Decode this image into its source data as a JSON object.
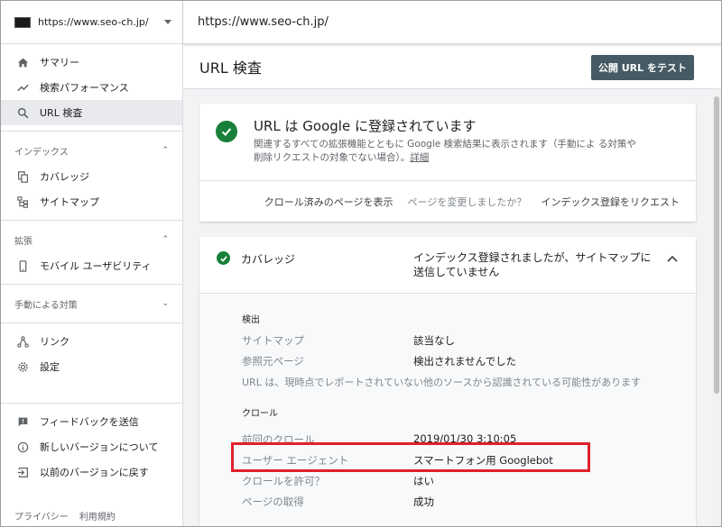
{
  "sidebar": {
    "property": "https://www.seo-ch.jp/",
    "nav_top": [
      {
        "label": "サマリー",
        "icon": "home-icon"
      },
      {
        "label": "検索パフォーマンス",
        "icon": "trending-up-icon"
      },
      {
        "label": "URL 検査",
        "icon": "search-icon",
        "active": true
      }
    ],
    "section_index": {
      "title": "インデックス",
      "items": [
        {
          "label": "カバレッジ",
          "icon": "copy-icon"
        },
        {
          "label": "サイトマップ",
          "icon": "sitemap-icon"
        }
      ]
    },
    "section_enh": {
      "title": "拡張",
      "items": [
        {
          "label": "モバイル ユーザビリティ",
          "icon": "phone-icon"
        }
      ]
    },
    "section_manual": {
      "title": "手動による対策"
    },
    "nav_misc": [
      {
        "label": "リンク",
        "icon": "links-icon"
      },
      {
        "label": "設定",
        "icon": "gear-icon"
      }
    ],
    "nav_bottom": [
      {
        "label": "フィードバックを送信",
        "icon": "feedback-icon"
      },
      {
        "label": "新しいバージョンについて",
        "icon": "info-icon"
      },
      {
        "label": "以前のバージョンに戻す",
        "icon": "exit-icon"
      }
    ],
    "footer": {
      "privacy": "プライバシー",
      "terms": "利用規約"
    }
  },
  "topbar": {
    "url": "https://www.seo-ch.jp/"
  },
  "main": {
    "title": "URL 検査",
    "test_button": "公開 URL をテスト",
    "status_card": {
      "title": "URL は Google に登録されています",
      "desc": "関連するすべての拡張機能とともに Google 検索結果に表示されます（手動によ る対策や削除リクエストの対象でない場合）。",
      "detail_link": "詳細",
      "actions": {
        "view_crawled": "クロール済みのページを表示",
        "changed_q": "ページを変更しましたか？",
        "request_index": "インデックス登録をリクエスト"
      }
    },
    "coverage_card": {
      "label": "カバレッジ",
      "status": "インデックス登録されましたが、サイトマップに送信していません",
      "discovery": {
        "title": "検出",
        "sitemap_label": "サイトマップ",
        "sitemap_value": "該当なし",
        "referring_label": "参照元ページ",
        "referring_value": "検出されませんでした",
        "note": "URL は、現時点でレポートされていない他のソースから認識されている可能性があります"
      },
      "crawl": {
        "title": "クロール",
        "last_crawl_label": "前回のクロール",
        "last_crawl_value": "2019/01/30 3:10:05",
        "user_agent_label": "ユーザー エージェント",
        "user_agent_value": "スマートフォン用 Googlebot",
        "crawl_allowed_label": "クロールを許可？",
        "crawl_allowed_value": "はい",
        "page_fetch_label": "ページの取得",
        "page_fetch_value": "成功"
      }
    }
  },
  "colors": {
    "accent_green": "#188038",
    "button_bg": "#455a64",
    "highlight_red": "#e0202c"
  }
}
